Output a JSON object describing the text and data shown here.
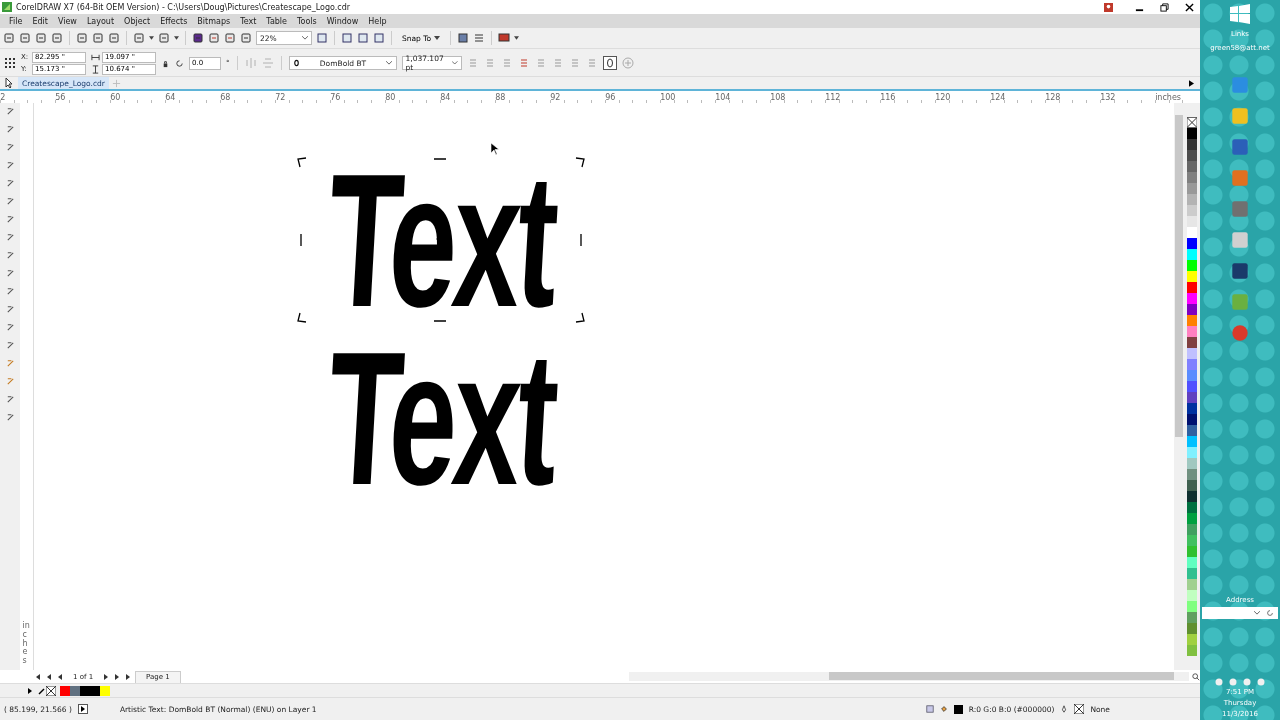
{
  "window": {
    "title": "CorelDRAW X7 (64-Bit OEM Version) - C:\\Users\\Doug\\Pictures\\Createscape_Logo.cdr"
  },
  "menu": [
    "File",
    "Edit",
    "View",
    "Layout",
    "Object",
    "Effects",
    "Bitmaps",
    "Text",
    "Table",
    "Tools",
    "Window",
    "Help"
  ],
  "toolbar": {
    "zoom": "22%",
    "snap": "Snap To"
  },
  "property_bar": {
    "x_label": "X:",
    "y_label": "Y:",
    "x": "82.295 \"",
    "y": "15.173 \"",
    "width": "19.097 \"",
    "height": "10.674 \"",
    "angle": "0.0",
    "angle_unit": "°",
    "font": "DomBold BT",
    "font_size": "1,037.107 pt"
  },
  "document_tabs": [
    {
      "label": "Createscape_Logo.cdr",
      "selected": true
    }
  ],
  "ruler": {
    "labels": [
      "2",
      "56",
      "60",
      "64",
      "68",
      "72",
      "76",
      "80",
      "84",
      "88",
      "92",
      "96",
      "100",
      "104",
      "108",
      "112",
      "116",
      "120",
      "124",
      "128",
      "132"
    ],
    "unit": "inches",
    "vertical_unit": "inches"
  },
  "canvas": {
    "objects": [
      {
        "text": "Text",
        "selected": true
      },
      {
        "text": "Text",
        "selected": false
      }
    ]
  },
  "page_nav": {
    "counter": "1 of 1",
    "tabs": [
      {
        "label": "Page 1",
        "selected": true
      }
    ]
  },
  "document_palette": [
    {
      "color": "#ff0000"
    },
    {
      "color": "#607080"
    },
    {
      "color": "#000000"
    },
    {
      "color": "#000000"
    },
    {
      "color": "#ffff00"
    }
  ],
  "color_palette": [
    {
      "color": "#000000"
    },
    {
      "color": "#333333"
    },
    {
      "color": "#4d4d4d"
    },
    {
      "color": "#666666"
    },
    {
      "color": "#808080"
    },
    {
      "color": "#999999"
    },
    {
      "color": "#b3b3b3"
    },
    {
      "color": "#cccccc"
    },
    {
      "color": "#e6e6e6"
    },
    {
      "color": "#ffffff"
    },
    {
      "color": "#0000ff"
    },
    {
      "color": "#00ffff"
    },
    {
      "color": "#00ff00"
    },
    {
      "color": "#ffff00"
    },
    {
      "color": "#ff0000"
    },
    {
      "color": "#ff00ff"
    },
    {
      "color": "#8000c0"
    },
    {
      "color": "#ff8000"
    },
    {
      "color": "#ff80c0"
    },
    {
      "color": "#804040"
    },
    {
      "color": "#c0c0ff"
    },
    {
      "color": "#8080ff"
    },
    {
      "color": "#5a8cff"
    },
    {
      "color": "#5050ff"
    },
    {
      "color": "#6040c0"
    },
    {
      "color": "#0030a0"
    },
    {
      "color": "#001070"
    },
    {
      "color": "#3060a0"
    },
    {
      "color": "#00c0ff"
    },
    {
      "color": "#80f0ff"
    },
    {
      "color": "#a0c8c0"
    },
    {
      "color": "#709080"
    },
    {
      "color": "#406050"
    },
    {
      "color": "#103030"
    },
    {
      "color": "#007040"
    },
    {
      "color": "#00a040"
    },
    {
      "color": "#40a060"
    },
    {
      "color": "#40c060"
    },
    {
      "color": "#30c030"
    },
    {
      "color": "#60ffc0"
    },
    {
      "color": "#30c090"
    },
    {
      "color": "#a0d090"
    },
    {
      "color": "#c0ffc0"
    },
    {
      "color": "#80ff80"
    },
    {
      "color": "#60a060"
    },
    {
      "color": "#609030"
    },
    {
      "color": "#a0d040"
    },
    {
      "color": "#80c040"
    }
  ],
  "status_bar": {
    "coordinates": "( 85.199, 21.566 )",
    "description": "Artistic Text: DomBold BT (Normal) (ENU) on Layer 1",
    "fill": {
      "color": "#000000",
      "label": "R:0 G:0 B:0 (#000000)"
    },
    "outline": "None"
  },
  "desktop_bar": {
    "links_title": "Links",
    "link": "green58@att.net",
    "address_title": "Address",
    "clock": {
      "time": "7:51 PM",
      "day": "Thursday",
      "date": "11/3/2016"
    }
  }
}
